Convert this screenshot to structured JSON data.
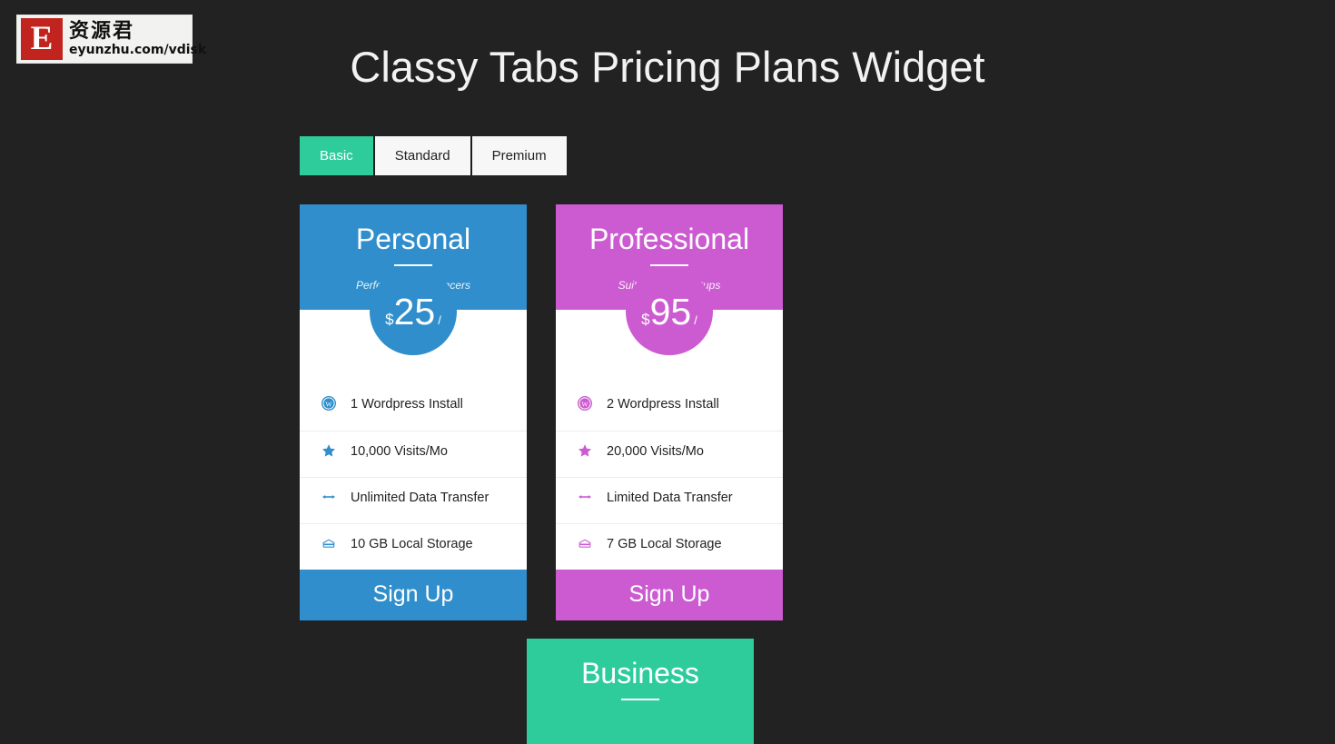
{
  "watermark": {
    "letter": "E",
    "cn_text": "资源君",
    "url_text": "eyunzhu.com/vdisk"
  },
  "header": {
    "title": "Classy Tabs Pricing Plans Widget"
  },
  "tabs": {
    "items": [
      {
        "label": "Basic",
        "active": true
      },
      {
        "label": "Standard",
        "active": false
      },
      {
        "label": "Premium",
        "active": false
      }
    ]
  },
  "colors": {
    "page_background": "#222222",
    "accent_green": "#2ecc9b",
    "personal_blue": "#2f8ecb",
    "professional_magenta": "#cc5bd1",
    "business_green": "#2ecc9b",
    "card_white": "#ffffff",
    "divider": "#ededed"
  },
  "plans": [
    {
      "name": "Personal",
      "subtitle": "Perfect For Freelancers",
      "color": "#2f8ecb",
      "currency": "$",
      "amount": "25",
      "period": "/",
      "signup_label": "Sign Up",
      "features": [
        {
          "icon": "wordpress-icon",
          "label": "1 Wordpress Install"
        },
        {
          "icon": "star-icon",
          "label": "10,000 Visits/Mo"
        },
        {
          "icon": "data-transfer-icon",
          "label": "Unlimited Data Transfer"
        },
        {
          "icon": "storage-icon",
          "label": "10 GB Local Storage"
        }
      ]
    },
    {
      "name": "Professional",
      "subtitle": "Suitable For Startups",
      "color": "#cc5bd1",
      "currency": "$",
      "amount": "95",
      "period": "/",
      "signup_label": "Sign Up",
      "features": [
        {
          "icon": "wordpress-icon",
          "label": "2 Wordpress Install"
        },
        {
          "icon": "star-icon",
          "label": "20,000 Visits/Mo"
        },
        {
          "icon": "data-transfer-icon",
          "label": "Limited Data Transfer"
        },
        {
          "icon": "storage-icon",
          "label": "7 GB Local Storage"
        }
      ]
    },
    {
      "name": "Business",
      "subtitle": "",
      "color": "#2ecc9b",
      "currency": "$",
      "amount": "",
      "period": "",
      "signup_label": "",
      "features": []
    }
  ]
}
